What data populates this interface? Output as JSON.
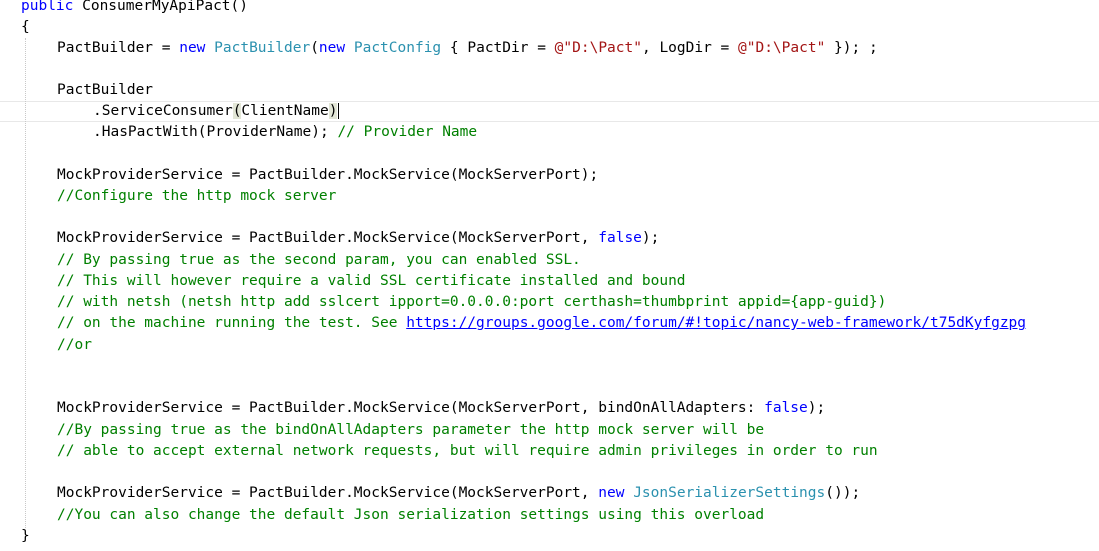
{
  "code": {
    "l1": {
      "kw": "public",
      "name": " ConsumerMyApiPact()"
    },
    "l2": {
      "text": "{"
    },
    "l3": {
      "a": "PactBuilder = ",
      "new1": "new",
      "t1": "PactBuilder",
      "b": "(",
      "new2": "new",
      "t2": "PactConfig",
      "c": " { PactDir = ",
      "s1": "@\"D:\\Pact\"",
      "d": ", LogDir = ",
      "s2": "@\"D:\\Pact\"",
      "e": " }); ;"
    },
    "l4": {
      "text": "PactBuilder"
    },
    "l5": {
      "a": ".ServiceConsumer",
      "p1": "(",
      "b": "ClientName",
      "p2": ")"
    },
    "l6": {
      "a": ".HasPactWith(ProviderName); ",
      "cmt": "// Provider Name"
    },
    "l7": {
      "text": "MockProviderService = PactBuilder.MockService(MockServerPort);"
    },
    "l8": {
      "cmt": "//Configure the http mock server"
    },
    "l9": {
      "a": "MockProviderService = PactBuilder.MockService(MockServerPort, ",
      "kw": "false",
      "b": ");"
    },
    "l10": {
      "cmt": "// By passing true as the second param, you can enabled SSL."
    },
    "l11": {
      "cmt": "// This will however require a valid SSL certificate installed and bound"
    },
    "l12": {
      "cmt": "// with netsh (netsh http add sslcert ipport=0.0.0.0:port certhash=thumbprint appid={app-guid})"
    },
    "l13": {
      "cmt": "// on the machine running the test. See ",
      "link": "https://groups.google.com/forum/#!topic/nancy-web-framework/t75dKyfgzpg"
    },
    "l14": {
      "cmt": "//or"
    },
    "l15": {
      "a": "MockProviderService = PactBuilder.MockService(MockServerPort, bindOnAllAdapters: ",
      "kw": "false",
      "b": ");"
    },
    "l16": {
      "cmt": "//By passing true as the bindOnAllAdapters parameter the http mock server will be"
    },
    "l17": {
      "cmt": "// able to accept external network requests, but will require admin privileges in order to run"
    },
    "l18": {
      "a": "MockProviderService = PactBuilder.MockService(MockServerPort, ",
      "kw": "new",
      "sp": " ",
      "t": "JsonSerializerSettings",
      "b": "());"
    },
    "l19": {
      "cmt": "//You can also change the default Json serialization settings using this overload"
    },
    "l20": {
      "text": "}"
    }
  },
  "colors": {
    "keyword": "#0000ff",
    "type": "#2b91af",
    "string": "#a31515",
    "comment": "#008000",
    "text": "#000000"
  }
}
